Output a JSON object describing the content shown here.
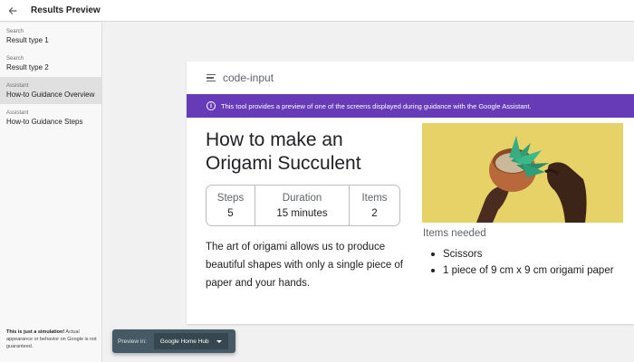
{
  "app": {
    "title": "Results Preview"
  },
  "sidebar": {
    "items": [
      {
        "category": "Search",
        "label": "Result type 1",
        "active": false
      },
      {
        "category": "Search",
        "label": "Result type 2",
        "active": false
      },
      {
        "category": "Assistant",
        "label": "How-to Guidance Overview",
        "active": true
      },
      {
        "category": "Assistant",
        "label": "How-to Guidance Steps",
        "active": false
      }
    ],
    "disclaimer_bold": "This is just a simulation!",
    "disclaimer_rest": " Actual appearance or behavior on Google is not guaranteed."
  },
  "card": {
    "header_icon": "menu-icon",
    "header_label": "code-input",
    "banner_icon": "info-icon",
    "banner_text": "This tool provides a preview of one of the screens displayed during guidance with the Google Assistant.",
    "title": "How to make an Origami Succulent",
    "stats": [
      {
        "heading": "Steps",
        "value": "5"
      },
      {
        "heading": "Duration",
        "value": "15 minutes"
      },
      {
        "heading": "Items",
        "value": "2"
      }
    ],
    "description": "The art of origami allows us to produce beautiful shapes with only a single piece of paper and your hands.",
    "items_heading": "Items needed",
    "items": [
      "Scissors",
      "1 piece of 9 cm x 9 cm origami paper"
    ]
  },
  "preview_bar": {
    "label": "Preview in:",
    "device": "Google Home Hub"
  },
  "colors": {
    "banner": "#673ab7",
    "preview_bar": "#455a64",
    "photo_bg": "#e6d266"
  }
}
